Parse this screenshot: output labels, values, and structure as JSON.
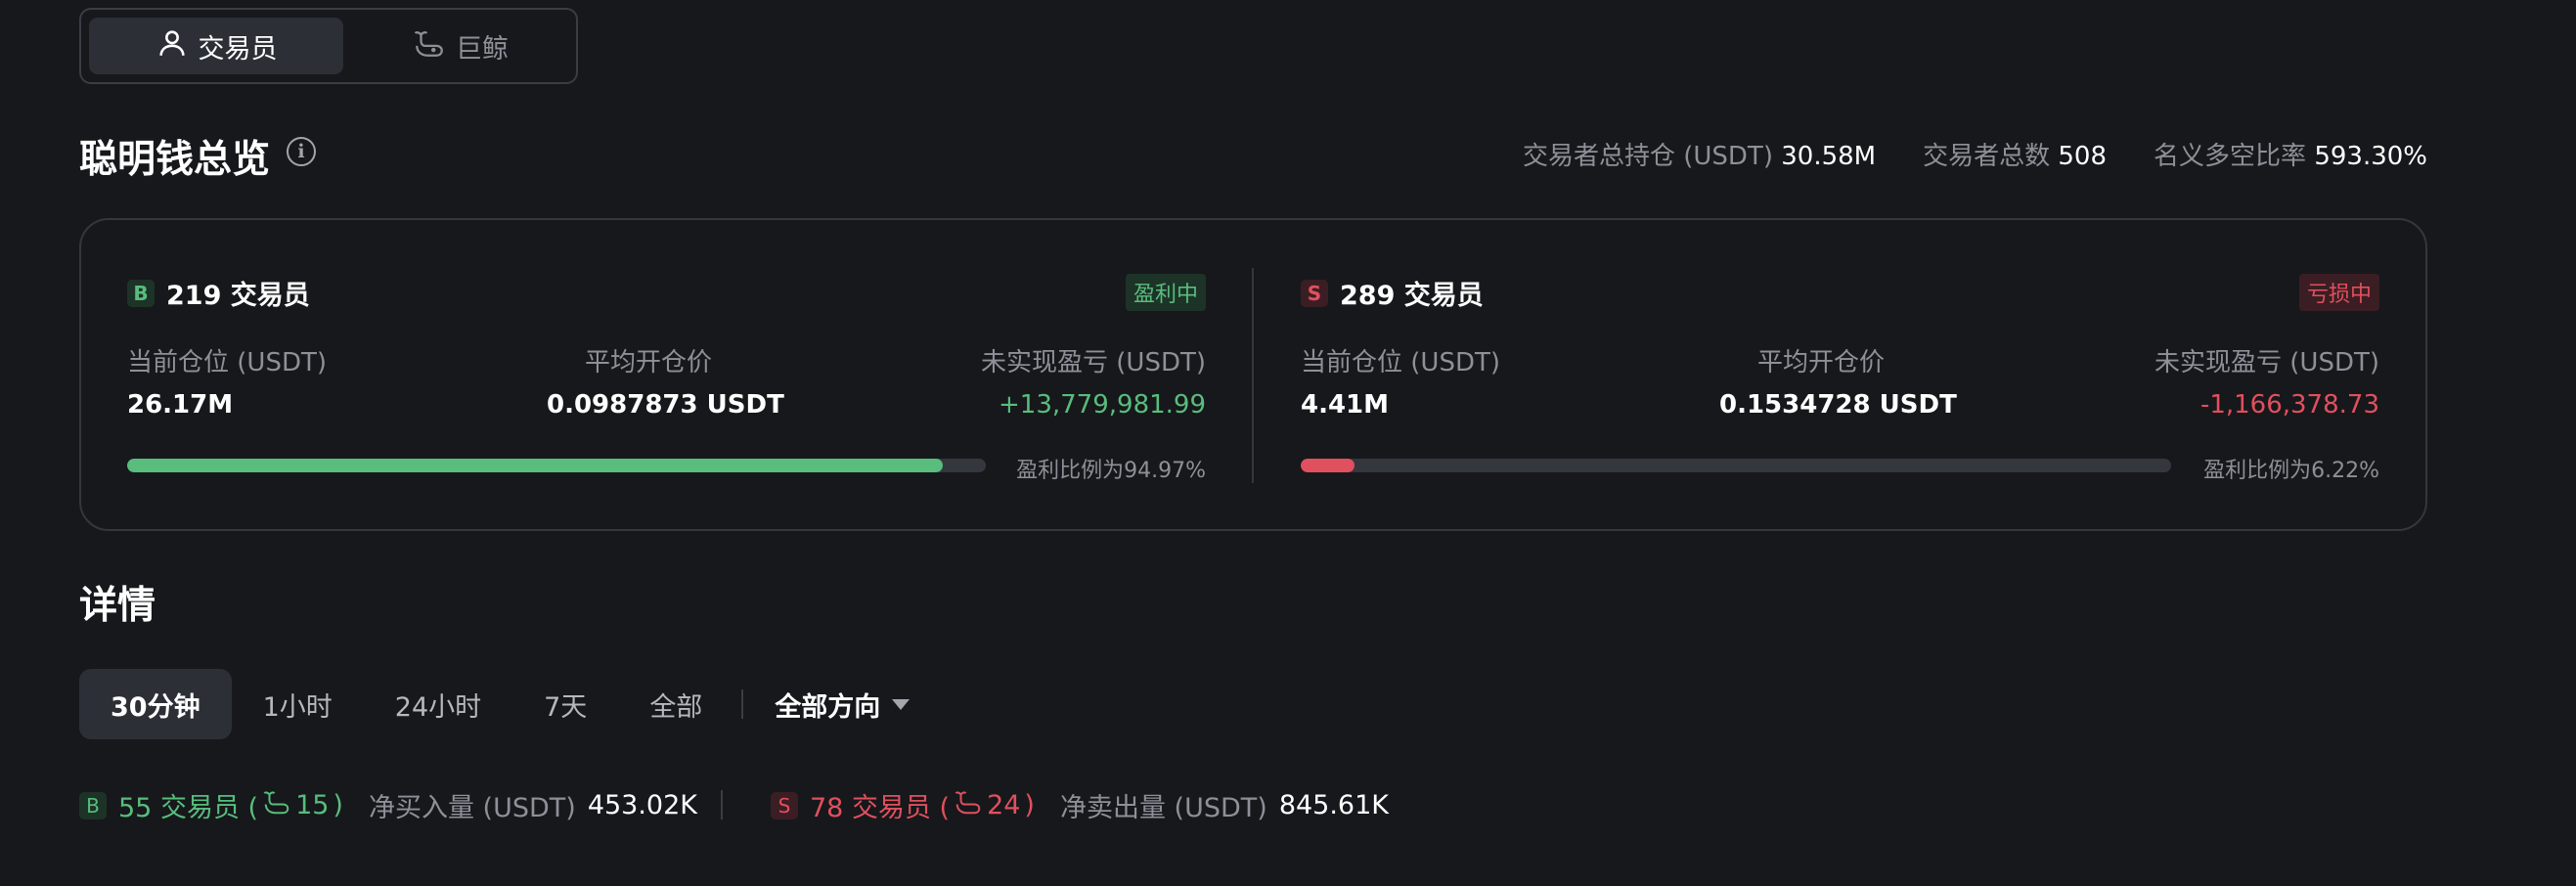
{
  "toggle": {
    "traders_label": "交易员",
    "whales_label": "巨鲸"
  },
  "overview": {
    "title": "聪明钱总览",
    "stats": [
      {
        "label": "交易者总持仓 (USDT)",
        "value": "30.58M"
      },
      {
        "label": "交易者总数",
        "value": "508"
      },
      {
        "label": "名义多空比率",
        "value": "593.30%"
      }
    ]
  },
  "long_side": {
    "badge": "B",
    "header": "219 交易员",
    "status": "盈利中",
    "position_label": "当前仓位 (USDT)",
    "position_value": "26.17M",
    "avg_price_label": "平均开仓价",
    "avg_price_value": "0.0987873 USDT",
    "pnl_label": "未实现盈亏 (USDT)",
    "pnl_value": "+13,779,981.99",
    "ratio_text": "盈利比例为94.97%",
    "ratio_fraction": 0.9497
  },
  "short_side": {
    "badge": "S",
    "header": "289 交易员",
    "status": "亏损中",
    "position_label": "当前仓位 (USDT)",
    "position_value": "4.41M",
    "avg_price_label": "平均开仓价",
    "avg_price_value": "0.1534728 USDT",
    "pnl_label": "未实现盈亏 (USDT)",
    "pnl_value": "-1,166,378.73",
    "ratio_text": "盈利比例为6.22%",
    "ratio_fraction": 0.0622
  },
  "details": {
    "title": "详情",
    "tabs": [
      "30分钟",
      "1小时",
      "24小时",
      "7天",
      "全部"
    ],
    "active_tab": "30分钟",
    "direction_label": "全部方向"
  },
  "flow": {
    "buy": {
      "badge": "B",
      "traders": "55 交易员 (",
      "whales": "15",
      "close": ")",
      "label": "净买入量 (USDT)",
      "value": "453.02K"
    },
    "sell": {
      "badge": "S",
      "traders": "78 交易员 (",
      "whales": "24",
      "close": ")",
      "label": "净卖出量 (USDT)",
      "value": "845.61K"
    }
  },
  "colors": {
    "profit": "#58bd7d",
    "loss": "#e0505e",
    "background": "#17181b"
  },
  "icons": {
    "trader": "person-icon",
    "whale": "whale-icon",
    "info": "info-icon",
    "direction": "caret-down-icon"
  }
}
